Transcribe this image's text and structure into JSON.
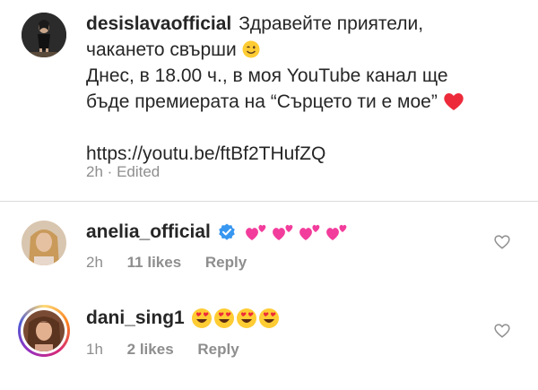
{
  "post": {
    "username": "desislavaofficial",
    "caption_line1": "Здравейте приятели,",
    "caption_line2": "чакането свърши",
    "caption_line2_emoji": "wink-emoji",
    "caption_line3": "Днес, в 18.00 ч., в моя  YouTube канал ще",
    "caption_line4": "бъде премиерата на “Сърцето ти е мое”",
    "caption_line4_emoji": "red-heart-emoji",
    "link": "https://youtu.be/ftBf2THufZQ",
    "time": "2h",
    "separator": "·",
    "edited": "Edited"
  },
  "comments": [
    {
      "username": "anelia_official",
      "verified": true,
      "emojis": [
        "pink-hearts-emoji",
        "pink-hearts-emoji",
        "pink-hearts-emoji",
        "pink-hearts-emoji"
      ],
      "time": "2h",
      "likes": "11 likes",
      "reply": "Reply"
    },
    {
      "username": "dani_sing1",
      "verified": false,
      "emojis": [
        "heart-eyes-emoji",
        "heart-eyes-emoji",
        "heart-eyes-emoji",
        "heart-eyes-emoji"
      ],
      "time": "1h",
      "likes": "2 likes",
      "reply": "Reply"
    }
  ],
  "colors": {
    "text": "#262626",
    "secondary": "#8e8e8e",
    "verified": "#3897f0",
    "heart_red": "#ed2a3a",
    "divider": "#dbdbdb"
  }
}
